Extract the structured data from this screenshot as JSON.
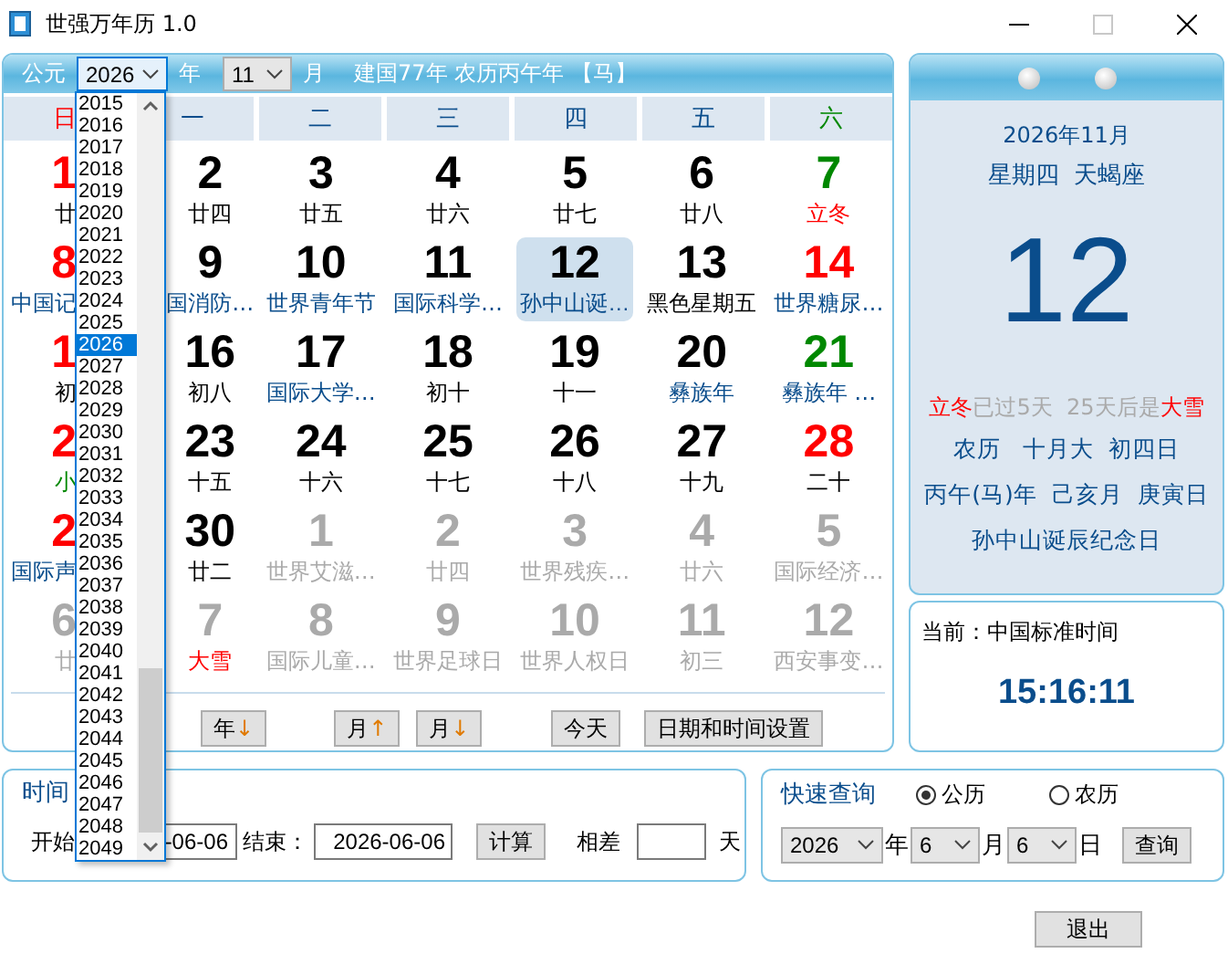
{
  "window": {
    "title": "世强万年历 1.0",
    "controls": [
      {
        "kind": "minimize",
        "disabled": false
      },
      {
        "kind": "maximize",
        "disabled": true
      },
      {
        "kind": "close",
        "disabled": false
      }
    ]
  },
  "calendar": {
    "era_label": "公元",
    "year_select": {
      "value": "2026",
      "open": true
    },
    "year_label": "年",
    "month_select": {
      "value": "11"
    },
    "month_label": "月",
    "info": "建国77年 农历丙午年 【马】",
    "weekdays": [
      {
        "label": "日",
        "kind": "sunday"
      },
      {
        "label": "一",
        "kind": "weekday"
      },
      {
        "label": "二",
        "kind": "weekday"
      },
      {
        "label": "三",
        "kind": "weekday"
      },
      {
        "label": "四",
        "kind": "weekday"
      },
      {
        "label": "五",
        "kind": "weekday"
      },
      {
        "label": "六",
        "kind": "saturday"
      }
    ],
    "weeks": [
      [
        {
          "number": {
            "text": "1",
            "kind": "rest"
          },
          "note": {
            "text": "廿",
            "kind": "lunar"
          },
          "selected": false
        },
        {
          "number": {
            "text": "2",
            "kind": "work"
          },
          "note": {
            "text": "廿四",
            "kind": "lunar"
          },
          "selected": false
        },
        {
          "number": {
            "text": "3",
            "kind": "work"
          },
          "note": {
            "text": "廿五",
            "kind": "lunar"
          },
          "selected": false
        },
        {
          "number": {
            "text": "4",
            "kind": "work"
          },
          "note": {
            "text": "廿六",
            "kind": "lunar"
          },
          "selected": false
        },
        {
          "number": {
            "text": "5",
            "kind": "work"
          },
          "note": {
            "text": "廿七",
            "kind": "lunar"
          },
          "selected": false
        },
        {
          "number": {
            "text": "6",
            "kind": "work"
          },
          "note": {
            "text": "廿八",
            "kind": "lunar"
          },
          "selected": false
        },
        {
          "number": {
            "text": "7",
            "kind": "term"
          },
          "note": {
            "text": "立冬",
            "kind": "term"
          },
          "selected": false
        }
      ],
      [
        {
          "number": {
            "text": "8",
            "kind": "rest"
          },
          "note": {
            "text": "中国记",
            "kind": "festival"
          },
          "selected": false
        },
        {
          "number": {
            "text": "9",
            "kind": "work"
          },
          "note": {
            "text": "国消防…",
            "kind": "festival"
          },
          "selected": false
        },
        {
          "number": {
            "text": "10",
            "kind": "work"
          },
          "note": {
            "text": "世界青年节",
            "kind": "festival"
          },
          "selected": false
        },
        {
          "number": {
            "text": "11",
            "kind": "work"
          },
          "note": {
            "text": "国际科学…",
            "kind": "festival"
          },
          "selected": false
        },
        {
          "number": {
            "text": "12",
            "kind": "work"
          },
          "note": {
            "text": "孙中山诞…",
            "kind": "festival"
          },
          "selected": true
        },
        {
          "number": {
            "text": "13",
            "kind": "work"
          },
          "note": {
            "text": "黑色星期五",
            "kind": "lunar"
          },
          "selected": false
        },
        {
          "number": {
            "text": "14",
            "kind": "rest"
          },
          "note": {
            "text": "世界糖尿…",
            "kind": "festival"
          },
          "selected": false
        }
      ],
      [
        {
          "number": {
            "text": "1",
            "kind": "rest"
          },
          "note": {
            "text": "初",
            "kind": "lunar"
          },
          "selected": false
        },
        {
          "number": {
            "text": "16",
            "kind": "work"
          },
          "note": {
            "text": "初八",
            "kind": "lunar"
          },
          "selected": false
        },
        {
          "number": {
            "text": "17",
            "kind": "work"
          },
          "note": {
            "text": "国际大学…",
            "kind": "festival"
          },
          "selected": false
        },
        {
          "number": {
            "text": "18",
            "kind": "work"
          },
          "note": {
            "text": "初十",
            "kind": "lunar"
          },
          "selected": false
        },
        {
          "number": {
            "text": "19",
            "kind": "work"
          },
          "note": {
            "text": "十一",
            "kind": "lunar"
          },
          "selected": false
        },
        {
          "number": {
            "text": "20",
            "kind": "work"
          },
          "note": {
            "text": "彝族年",
            "kind": "festival"
          },
          "selected": false
        },
        {
          "number": {
            "text": "21",
            "kind": "term"
          },
          "note": {
            "text": "彝族年 …",
            "kind": "festival"
          },
          "selected": false
        }
      ],
      [
        {
          "number": {
            "text": "2",
            "kind": "rest"
          },
          "note": {
            "text": "小",
            "kind": "minor_term"
          },
          "selected": false
        },
        {
          "number": {
            "text": "23",
            "kind": "work"
          },
          "note": {
            "text": "十五",
            "kind": "lunar"
          },
          "selected": false
        },
        {
          "number": {
            "text": "24",
            "kind": "work"
          },
          "note": {
            "text": "十六",
            "kind": "lunar"
          },
          "selected": false
        },
        {
          "number": {
            "text": "25",
            "kind": "work"
          },
          "note": {
            "text": "十七",
            "kind": "lunar"
          },
          "selected": false
        },
        {
          "number": {
            "text": "26",
            "kind": "work"
          },
          "note": {
            "text": "十八",
            "kind": "lunar"
          },
          "selected": false
        },
        {
          "number": {
            "text": "27",
            "kind": "work"
          },
          "note": {
            "text": "十九",
            "kind": "lunar"
          },
          "selected": false
        },
        {
          "number": {
            "text": "28",
            "kind": "rest"
          },
          "note": {
            "text": "二十",
            "kind": "lunar"
          },
          "selected": false
        }
      ],
      [
        {
          "number": {
            "text": "2",
            "kind": "rest"
          },
          "note": {
            "text": "国际声",
            "kind": "festival"
          },
          "selected": false
        },
        {
          "number": {
            "text": "30",
            "kind": "work"
          },
          "note": {
            "text": "廿二",
            "kind": "lunar"
          },
          "selected": false
        },
        {
          "number": {
            "text": "1",
            "kind": "other"
          },
          "note": {
            "text": "世界艾滋…",
            "kind": "other"
          },
          "selected": false
        },
        {
          "number": {
            "text": "2",
            "kind": "other"
          },
          "note": {
            "text": "廿四",
            "kind": "other"
          },
          "selected": false
        },
        {
          "number": {
            "text": "3",
            "kind": "other"
          },
          "note": {
            "text": "世界残疾…",
            "kind": "other"
          },
          "selected": false
        },
        {
          "number": {
            "text": "4",
            "kind": "other"
          },
          "note": {
            "text": "廿六",
            "kind": "other"
          },
          "selected": false
        },
        {
          "number": {
            "text": "5",
            "kind": "other"
          },
          "note": {
            "text": "国际经济…",
            "kind": "other"
          },
          "selected": false
        }
      ],
      [
        {
          "number": {
            "text": "6",
            "kind": "other"
          },
          "note": {
            "text": "廿",
            "kind": "other"
          },
          "selected": false
        },
        {
          "number": {
            "text": "7",
            "kind": "other"
          },
          "note": {
            "text": "大雪",
            "kind": "term"
          },
          "selected": false
        },
        {
          "number": {
            "text": "8",
            "kind": "other"
          },
          "note": {
            "text": "国际儿童…",
            "kind": "other"
          },
          "selected": false
        },
        {
          "number": {
            "text": "9",
            "kind": "other"
          },
          "note": {
            "text": "世界足球日",
            "kind": "other"
          },
          "selected": false
        },
        {
          "number": {
            "text": "10",
            "kind": "other"
          },
          "note": {
            "text": "世界人权日",
            "kind": "other"
          },
          "selected": false
        },
        {
          "number": {
            "text": "11",
            "kind": "other"
          },
          "note": {
            "text": "初三",
            "kind": "other"
          },
          "selected": false
        },
        {
          "number": {
            "text": "12",
            "kind": "other"
          },
          "note": {
            "text": "西安事变…",
            "kind": "other"
          },
          "selected": false
        }
      ]
    ],
    "buttons": [
      {
        "label": "年",
        "arrow": "↓"
      },
      {
        "label": "月",
        "arrow": "↑"
      },
      {
        "label": "月",
        "arrow": "↓"
      },
      {
        "label": "今天"
      },
      {
        "label": "日期和时间设置"
      }
    ]
  },
  "year_dropdown": {
    "options": [
      {
        "label": "2015",
        "selected": false
      },
      {
        "label": "2016",
        "selected": false
      },
      {
        "label": "2017",
        "selected": false
      },
      {
        "label": "2018",
        "selected": false
      },
      {
        "label": "2019",
        "selected": false
      },
      {
        "label": "2020",
        "selected": false
      },
      {
        "label": "2021",
        "selected": false
      },
      {
        "label": "2022",
        "selected": false
      },
      {
        "label": "2023",
        "selected": false
      },
      {
        "label": "2024",
        "selected": false
      },
      {
        "label": "2025",
        "selected": false
      },
      {
        "label": "2026",
        "selected": true
      },
      {
        "label": "2027",
        "selected": false
      },
      {
        "label": "2028",
        "selected": false
      },
      {
        "label": "2029",
        "selected": false
      },
      {
        "label": "2030",
        "selected": false
      },
      {
        "label": "2031",
        "selected": false
      },
      {
        "label": "2032",
        "selected": false
      },
      {
        "label": "2033",
        "selected": false
      },
      {
        "label": "2034",
        "selected": false
      },
      {
        "label": "2035",
        "selected": false
      },
      {
        "label": "2036",
        "selected": false
      },
      {
        "label": "2037",
        "selected": false
      },
      {
        "label": "2038",
        "selected": false
      },
      {
        "label": "2039",
        "selected": false
      },
      {
        "label": "2040",
        "selected": false
      },
      {
        "label": "2041",
        "selected": false
      },
      {
        "label": "2042",
        "selected": false
      },
      {
        "label": "2043",
        "selected": false
      },
      {
        "label": "2044",
        "selected": false
      },
      {
        "label": "2045",
        "selected": false
      },
      {
        "label": "2046",
        "selected": false
      },
      {
        "label": "2047",
        "selected": false
      },
      {
        "label": "2048",
        "selected": false
      },
      {
        "label": "2049",
        "selected": false
      }
    ]
  },
  "day_card": {
    "month_line": "2026年11月",
    "weekday": "星期四",
    "zodiac": "天蝎座",
    "day": "12",
    "term_parts": [
      {
        "text": "立冬",
        "kind": "term"
      },
      {
        "text": "已过5天  25天后是",
        "kind": "plain"
      },
      {
        "text": "大雪",
        "kind": "term"
      }
    ],
    "lunar_lines": [
      "农历   十月大  初四日",
      "丙午(马)年  己亥月  庚寅日"
    ],
    "festival": "孙中山诞辰纪念日"
  },
  "clock": {
    "label": "当前：中国标准时间",
    "time": "15:16:11"
  },
  "interval": {
    "title": "时间",
    "start_label": "开始",
    "start_value": "-06-06",
    "end_label": "结束：",
    "end_value": "2026-06-06",
    "calc_button": "计算",
    "diff_label": "相差",
    "unit": "天"
  },
  "quick_query": {
    "title": "快速查询",
    "radios": [
      {
        "label": "公历",
        "selected": true
      },
      {
        "label": "农历",
        "selected": false
      }
    ],
    "year": "2026",
    "year_unit": "年",
    "month": "6",
    "month_unit": "月",
    "day": "6",
    "day_unit": "日",
    "button": "查询"
  },
  "exit_button": "退出"
}
